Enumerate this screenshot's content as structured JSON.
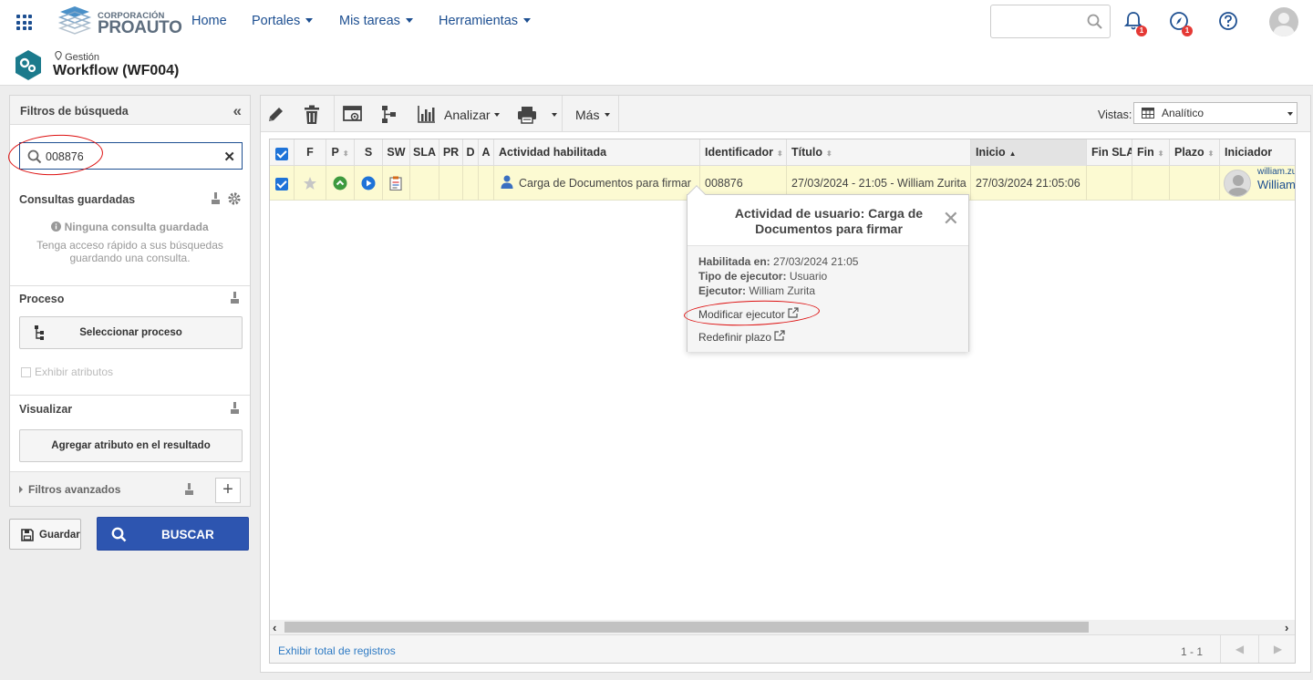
{
  "brand": {
    "line1": "CORPORACIÓN",
    "line2": "PROAUTO"
  },
  "nav": [
    "Home",
    "Portales",
    "Mis tareas",
    "Herramientas"
  ],
  "notifications": {
    "bell_count": "1",
    "compass_count": "1"
  },
  "header": {
    "breadcrumb": "Gestión",
    "title": "Workflow (WF004)"
  },
  "sidebar": {
    "title": "Filtros de búsqueda",
    "search_value": "008876",
    "saved_title": "Consultas guardadas",
    "saved_empty_title": "Ninguna consulta guardada",
    "saved_empty_text": "Tenga acceso rápido a sus búsquedas guardando una consulta.",
    "process_title": "Proceso",
    "select_process": "Seleccionar proceso",
    "show_attributes": "Exhibir atributos",
    "visualize_title": "Visualizar",
    "add_attribute": "Agregar atributo en el resultado",
    "advanced_filters": "Filtros avanzados",
    "save_button": "Guardar",
    "search_button": "BUSCAR"
  },
  "toolbar": {
    "analyze": "Analizar",
    "more": "Más",
    "views_label": "Vistas:",
    "views_value": "Analítico"
  },
  "columns": [
    "F",
    "P",
    "S",
    "SW",
    "SLA",
    "PR",
    "D",
    "A",
    "Actividad habilitada",
    "Identificador",
    "Título",
    "Inicio",
    "Fin SLA",
    "Fin",
    "Plazo",
    "Iniciador"
  ],
  "row": {
    "activity": "Carga de Documentos para firmar",
    "identifier": "008876",
    "title": "27/03/2024 - 21:05 - William Zurita",
    "start": "27/03/2024 21:05:06",
    "initiator_login": "william.zu",
    "initiator_name": "William"
  },
  "popup": {
    "title": "Actividad de usuario: Carga de Documentos para firmar",
    "enabled_label": "Habilitada en:",
    "enabled_value": "27/03/2024 21:05",
    "type_label": "Tipo de ejecutor:",
    "type_value": "Usuario",
    "executor_label": "Ejecutor:",
    "executor_value": "William Zurita",
    "modify_link": "Modificar ejecutor",
    "redefine_link": "Redefinir plazo"
  },
  "footer": {
    "show_total": "Exhibir total de registros",
    "range": "1 - 1"
  },
  "colors": {
    "accent": "#1d4f91",
    "search_button": "#2d55b0",
    "row_highlight": "#fcfad2",
    "annotation": "#dd1111"
  }
}
